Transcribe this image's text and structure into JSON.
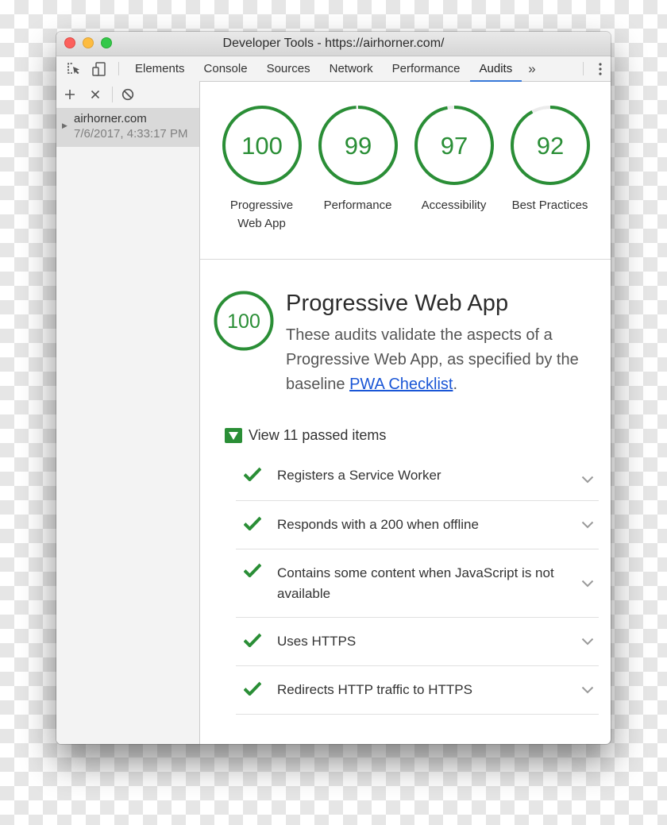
{
  "window": {
    "title": "Developer Tools - https://airhorner.com/"
  },
  "toolbar": {
    "tabs": [
      {
        "label": "Elements",
        "active": false
      },
      {
        "label": "Console",
        "active": false
      },
      {
        "label": "Sources",
        "active": false
      },
      {
        "label": "Network",
        "active": false
      },
      {
        "label": "Performance",
        "active": false
      },
      {
        "label": "Audits",
        "active": true
      }
    ],
    "more_label": "»",
    "icons": [
      "inspect-element-icon",
      "device-toolbar-icon",
      "more-tabs-icon",
      "kebab-menu-icon"
    ]
  },
  "sidebar": {
    "buttons": [
      "add-icon",
      "close-icon",
      "clear-icon"
    ],
    "reports": [
      {
        "name": "airhorner.com",
        "date": "7/6/2017, 4:33:17 PM"
      }
    ]
  },
  "scores": [
    {
      "value": 100,
      "label": "Progressive Web App"
    },
    {
      "value": 99,
      "label": "Performance"
    },
    {
      "value": 97,
      "label": "Accessibility"
    },
    {
      "value": 92,
      "label": "Best Practices"
    }
  ],
  "category": {
    "score": 100,
    "title": "Progressive Web App",
    "description_prefix": "These audits validate the aspects of a Progressive Web App, as specified by the baseline ",
    "link_text": "PWA Checklist",
    "description_suffix": "."
  },
  "passed": {
    "label": "View 11 passed items",
    "count": 11
  },
  "audits": [
    {
      "title": "Registers a Service Worker",
      "status": "pass"
    },
    {
      "title": "Responds with a 200 when offline",
      "status": "pass"
    },
    {
      "title": "Contains some content when JavaScript is not available",
      "status": "pass"
    },
    {
      "title": "Uses HTTPS",
      "status": "pass"
    },
    {
      "title": "Redirects HTTP traffic to HTTPS",
      "status": "pass"
    }
  ],
  "colors": {
    "pass_green": "#2a8e36",
    "gauge_track": "#ebebeb",
    "link_blue": "#1a56d6",
    "active_tab_underline": "#3879d9"
  }
}
